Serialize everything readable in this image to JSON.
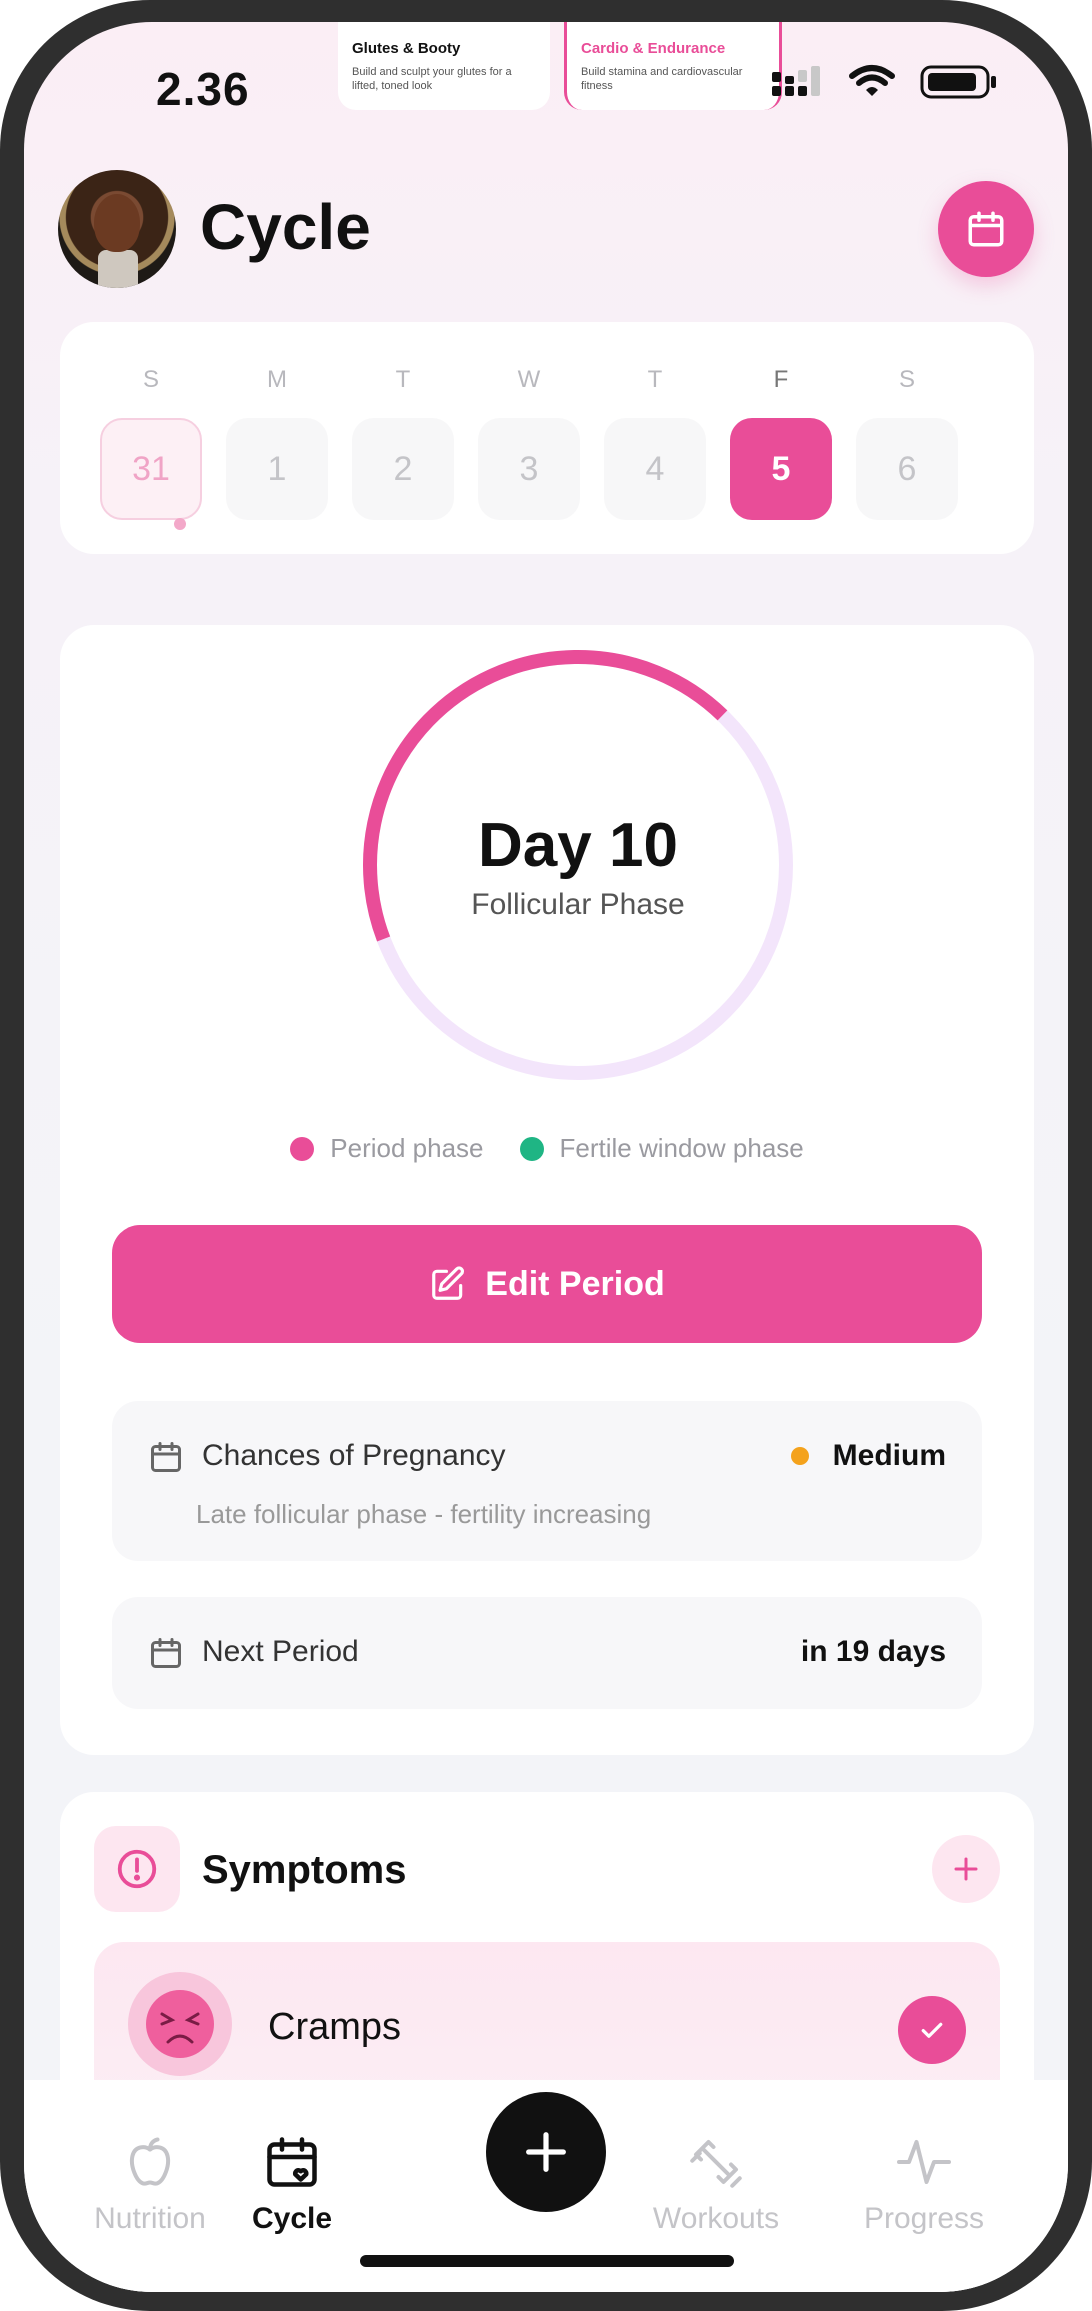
{
  "status_bar": {
    "time": "2.36"
  },
  "peek_cards": [
    {
      "title": "Glutes & Booty",
      "subtitle": "Build and sculpt your glutes for a lifted, toned look"
    },
    {
      "title": "Cardio & Endurance",
      "subtitle": "Build stamina and cardiovascular fitness"
    }
  ],
  "header": {
    "title": "Cycle",
    "calendar_icon": "calendar-icon"
  },
  "week": {
    "days": [
      "S",
      "M",
      "T",
      "W",
      "T",
      "F",
      "S"
    ],
    "dates": [
      "31",
      "1",
      "2",
      "3",
      "4",
      "5",
      "6"
    ],
    "today_index": 0,
    "selected_index": 5
  },
  "cycle": {
    "day_label": "Day 10",
    "phase": "Follicular Phase",
    "progress_fraction": 0.43
  },
  "legend": [
    {
      "label": "Period phase",
      "color": "#e94d98"
    },
    {
      "label": "Fertile window phase",
      "color": "#1fb584"
    }
  ],
  "edit_button": {
    "label": "Edit Period",
    "icon": "edit-icon"
  },
  "pregnancy": {
    "label": "Chances of Pregnancy",
    "value": "Medium",
    "value_color": "#f4a21c",
    "note": "Late follicular phase - fertility increasing"
  },
  "next_period": {
    "label": "Next Period",
    "value": "in 19 days"
  },
  "symptoms": {
    "title": "Symptoms",
    "items": [
      {
        "label": "Cramps",
        "checked": true
      }
    ]
  },
  "nav": {
    "items": [
      "Nutrition",
      "Cycle",
      "Workouts",
      "Progress"
    ],
    "active": "Cycle"
  },
  "colors": {
    "accent": "#e94d98",
    "accent_light": "#fde6f0",
    "ring_track": "#f3e5fb"
  }
}
